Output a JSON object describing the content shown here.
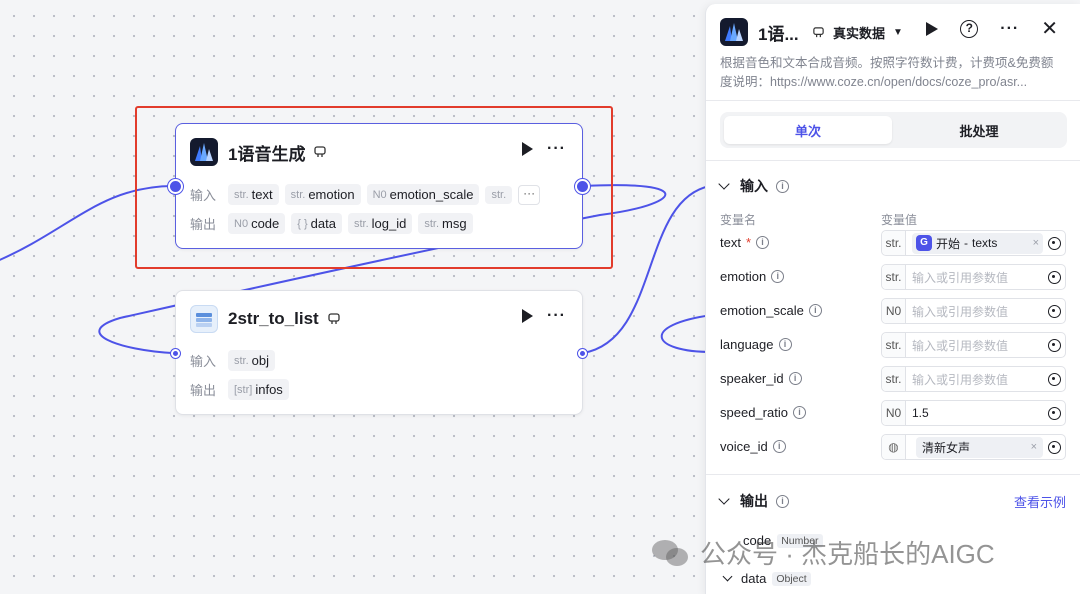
{
  "nodes": {
    "voice_node": {
      "title": "1语音生成",
      "input_label": "输入",
      "output_label": "输出",
      "inputs": [
        {
          "type": "str.",
          "name": "text"
        },
        {
          "type": "str.",
          "name": "emotion"
        },
        {
          "type": "N0",
          "name": "emotion_scale"
        },
        {
          "type": "str.",
          "name": ""
        }
      ],
      "more_label": "···",
      "outputs": [
        {
          "type": "N0",
          "name": "code"
        },
        {
          "type": "{ }",
          "name": "data"
        },
        {
          "type": "str.",
          "name": "log_id"
        },
        {
          "type": "str.",
          "name": "msg"
        }
      ]
    },
    "list_node": {
      "title": "2str_to_list",
      "input_label": "输入",
      "output_label": "输出",
      "inputs": [
        {
          "type": "str.",
          "name": "obj"
        }
      ],
      "outputs": [
        {
          "type": "[str]",
          "name": "infos"
        }
      ]
    }
  },
  "panel": {
    "title": "1语...",
    "dataset_label": "真实数据",
    "description_line1": "根据音色和文本合成音频。按照字符数计费，计费项&免费额",
    "description_line2": "度说明：https://www.coze.cn/open/docs/coze_pro/asr...",
    "tabs": {
      "single": "单次",
      "batch": "批处理"
    },
    "input_section": "输入",
    "col_name": "变量名",
    "col_value": "变量值",
    "params": [
      {
        "name": "text",
        "required": "*",
        "type": "str.",
        "ref_source": "开始",
        "ref_sep": " - ",
        "ref_field": "texts",
        "clear": "×"
      },
      {
        "name": "emotion",
        "type": "str.",
        "placeholder": "输入或引用参数值"
      },
      {
        "name": "emotion_scale",
        "type": "N0",
        "placeholder": "输入或引用参数值"
      },
      {
        "name": "language",
        "type": "str.",
        "placeholder": "输入或引用参数值"
      },
      {
        "name": "speaker_id",
        "type": "str.",
        "placeholder": "输入或引用参数值"
      },
      {
        "name": "speed_ratio",
        "type": "N0",
        "value": "1.5"
      },
      {
        "name": "voice_id",
        "value": "清新女声",
        "clear": "×"
      }
    ],
    "output_section": "输出",
    "example_link": "查看示例",
    "outputs": [
      {
        "name": "code",
        "type": "Number"
      },
      {
        "name": "data",
        "type": "Object"
      }
    ]
  },
  "watermark": "公众号 · 杰克船长的AIGC"
}
